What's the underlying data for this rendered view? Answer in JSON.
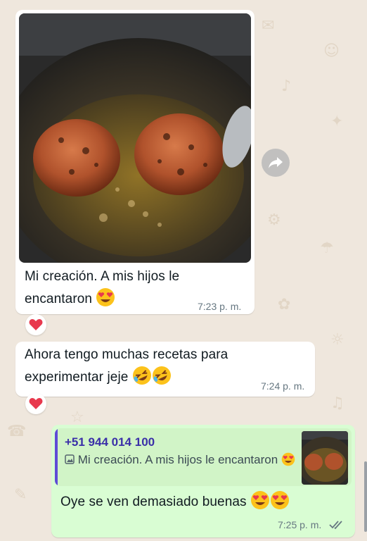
{
  "messages": [
    {
      "caption": "Mi creación. A mis hijos le encantaron",
      "time": "7:23 p. m.",
      "reaction": "heart"
    },
    {
      "text": "Ahora tengo muchas recetas para experimentar jeje",
      "time": "7:24 p. m.",
      "reaction": "heart"
    },
    {
      "reply": {
        "sender": "+51 944 014 100",
        "quoted_text": "Mi creación. A mis hijos le encantaron"
      },
      "text": "Oye se ven demasiado buenas",
      "time": "7:25 p. m.",
      "status": "read"
    }
  ],
  "colors": {
    "chat_background": "#efe7dd",
    "incoming_bubble": "#ffffff",
    "outgoing_bubble": "#d9fdd3",
    "quote_bar": "#5e4bd6",
    "read_ticks": "#667781",
    "heart": "#e8384d"
  }
}
